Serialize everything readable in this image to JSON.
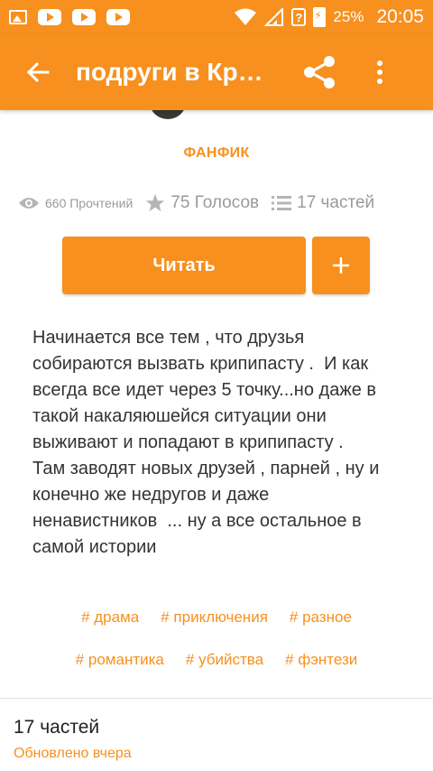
{
  "status_bar": {
    "battery_pct": "25%",
    "time": "20:05",
    "icons": [
      "image-icon",
      "youtube-icon",
      "youtube-icon",
      "youtube-icon",
      "wifi-icon",
      "signal-icon",
      "question-icon",
      "battery-icon"
    ]
  },
  "appbar": {
    "title": "подруги в Кр…",
    "back_icon": "arrow-left-icon",
    "share_icon": "share-icon",
    "more_icon": "more-vertical-icon"
  },
  "story": {
    "category": "ФАНФИК",
    "reads": "660 Прочтений",
    "votes": "75 Голосов",
    "parts": "17 частей",
    "read_button": "Читать",
    "add_button": "+",
    "description": "Начинается все тем , что друзья\nсобираются вызвать крипипасту .  И как\nвсегда все идет через 5 точку...но даже в\nтакой накаляюшейся ситуации они\nвыживают и попадают в крипипасту .\nТам заводят новых друзей , парней , ну и\nконечно же недругов и даже\nненавистников  ... ну а все остальное в\nсамой истории",
    "tags_row1": [
      "# драма",
      "# приключения",
      "# разное"
    ],
    "tags_row2": [
      "# романтика",
      "# убийства",
      "# фэнтези"
    ]
  },
  "parts_section": {
    "title": "17 частей",
    "updated": "Обновлено вчера"
  },
  "colors": {
    "accent": "#f7901e",
    "text": "#333333",
    "muted": "#9a9a9a"
  }
}
